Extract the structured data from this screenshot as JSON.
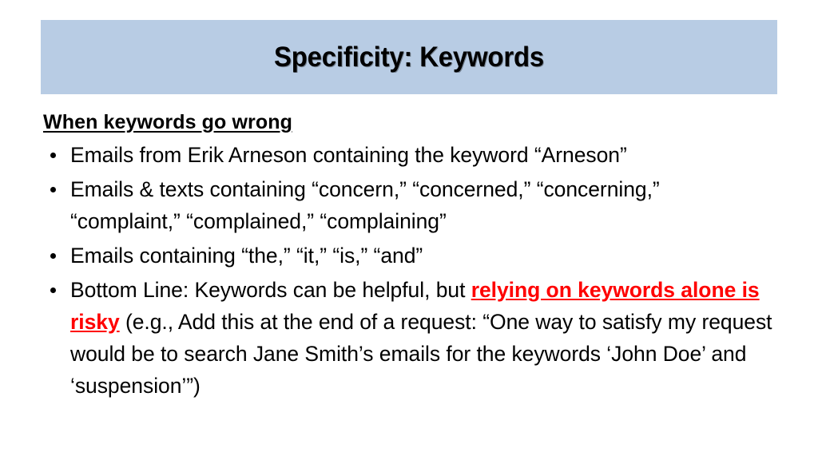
{
  "slide": {
    "title": "Specificity: Keywords",
    "banner_color": "#b8cce4",
    "background_color": "#ffffff",
    "text_color": "#000000",
    "accent_color": "#ff0000"
  },
  "body": {
    "lead_heading": "When keywords go wrong",
    "bullets": [
      {
        "id": "bullet-arneson",
        "text": "Emails from Erik Arneson containing the keyword “Arneson”"
      },
      {
        "id": "bullet-concern",
        "text": "Emails & texts containing “concern,” “concerned,” “concerning,” “complaint,” “complained,” “complaining”"
      },
      {
        "id": "bullet-stopwords",
        "text": "Emails containing “the,” “it,” “is,” “and”"
      },
      {
        "id": "bullet-bottom-line",
        "parts": {
          "lead": "Bottom Line: Keywords can be helpful, but ",
          "emphasis": "relying on keywords alone is risky",
          "tail": " (e.g., Add this at the end of a request: “One way to satisfy my request would be to search Jane Smith’s emails for the keywords ‘John Doe’ and ‘suspension’”)"
        }
      }
    ]
  }
}
